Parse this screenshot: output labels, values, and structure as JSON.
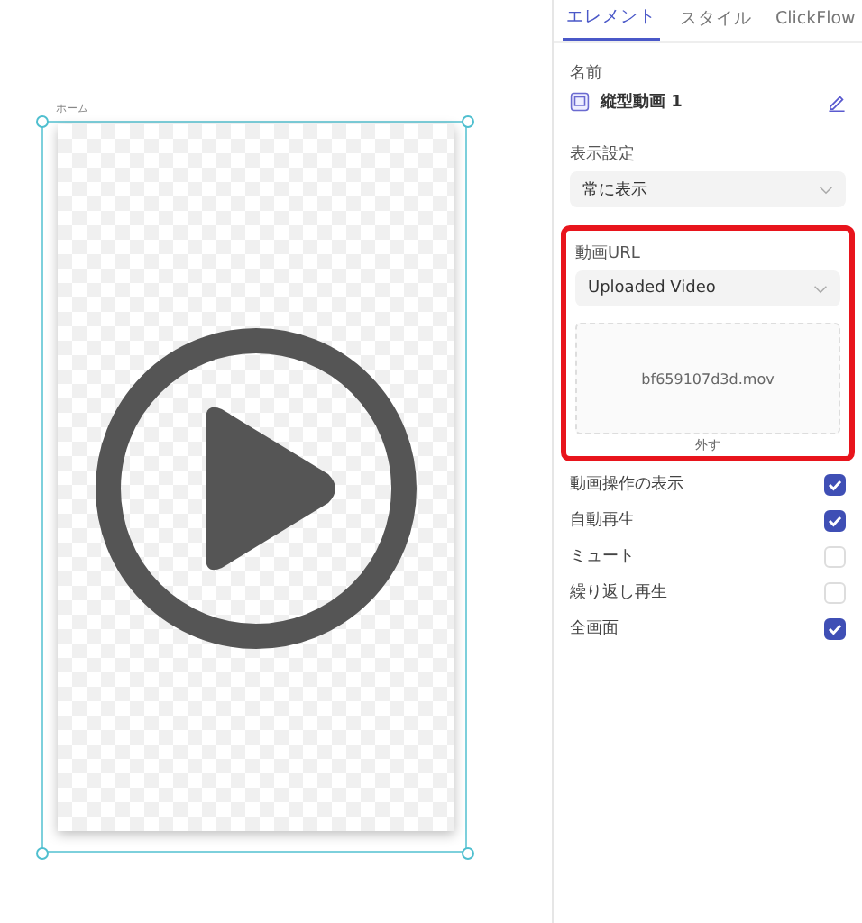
{
  "canvas": {
    "screen_label": "ホーム"
  },
  "tabs": [
    {
      "label": "エレメント",
      "selected": true
    },
    {
      "label": "スタイル",
      "selected": false
    },
    {
      "label": "ClickFlow",
      "selected": false
    }
  ],
  "name_field": {
    "label": "名前",
    "value": "縦型動画 1"
  },
  "visibility": {
    "label": "表示設定",
    "value": "常に表示"
  },
  "video_url": {
    "label": "動画URL",
    "value": "Uploaded Video",
    "file": "bf659107d3d.mov",
    "remove": "外す",
    "highlighted": true
  },
  "options": [
    {
      "label": "動画操作の表示",
      "checked": true
    },
    {
      "label": "自動再生",
      "checked": true
    },
    {
      "label": "ミュート",
      "checked": false
    },
    {
      "label": "繰り返し再生",
      "checked": false
    },
    {
      "label": "全画面",
      "checked": true
    }
  ]
}
